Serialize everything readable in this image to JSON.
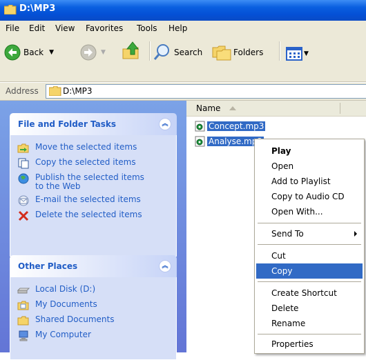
{
  "window": {
    "title": "D:\\MP3"
  },
  "menu": {
    "items": [
      "File",
      "Edit",
      "View",
      "Favorites",
      "Tools",
      "Help"
    ]
  },
  "toolbar": {
    "back_label": "Back",
    "search_label": "Search",
    "folders_label": "Folders"
  },
  "address": {
    "label": "Address",
    "value": "D:\\MP3"
  },
  "file_tasks": {
    "title": "File and Folder Tasks",
    "items": [
      {
        "label": "Move the selected items",
        "icon": "move-icon"
      },
      {
        "label": "Copy the selected items",
        "icon": "copy-icon"
      },
      {
        "label": "Publish the selected items to the Web",
        "icon": "publish-web-icon"
      },
      {
        "label": "E-mail the selected items",
        "icon": "email-icon"
      },
      {
        "label": "Delete the selected items",
        "icon": "delete-x-icon"
      }
    ]
  },
  "other_places": {
    "title": "Other Places",
    "items": [
      {
        "label": "Local Disk (D:)",
        "icon": "disk-icon"
      },
      {
        "label": "My Documents",
        "icon": "documents-folder-icon"
      },
      {
        "label": "Shared Documents",
        "icon": "shared-folder-icon"
      },
      {
        "label": "My Computer",
        "icon": "computer-icon"
      }
    ]
  },
  "file_list": {
    "column_name": "Name",
    "files": [
      "Concept.mp3",
      "Analyse.mp3"
    ]
  },
  "context_menu": {
    "groups": [
      [
        "Play",
        "Open",
        "Add to Playlist",
        "Copy to Audio CD",
        "Open With..."
      ],
      [
        "Send To"
      ],
      [
        "Cut",
        "Copy"
      ],
      [
        "Create Shortcut",
        "Delete",
        "Rename"
      ],
      [
        "Properties"
      ]
    ],
    "default_item": "Play",
    "highlighted_item": "Copy"
  },
  "colors": {
    "titlebar": "#0a5fe0",
    "taskpane": "#6f8fe0",
    "selection": "#316ac5",
    "task_link": "#215dc6"
  }
}
